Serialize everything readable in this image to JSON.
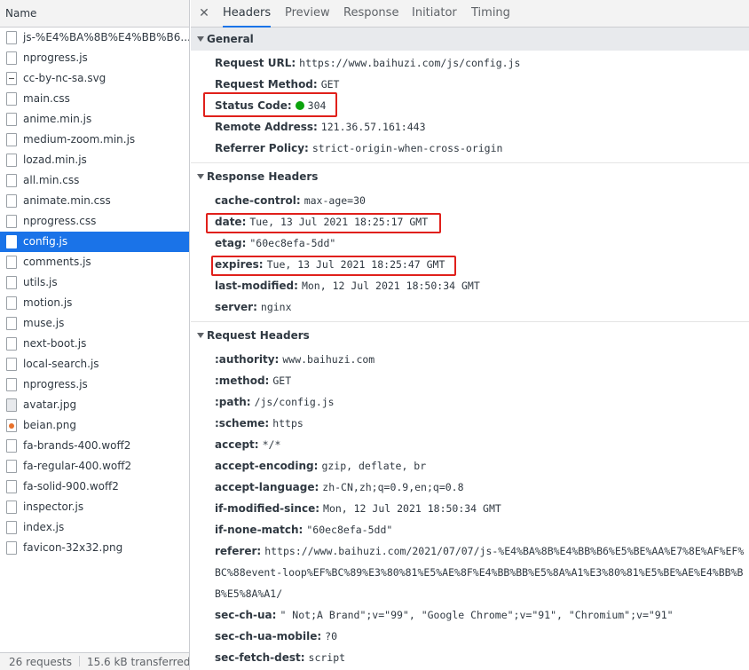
{
  "left_panel": {
    "header": "Name",
    "files": [
      {
        "name": "js-%E4%BA%8B%E4%BB%B6...",
        "type": "doc",
        "selected": false
      },
      {
        "name": "nprogress.js",
        "type": "doc",
        "selected": false
      },
      {
        "name": "cc-by-nc-sa.svg",
        "type": "svg",
        "selected": false
      },
      {
        "name": "main.css",
        "type": "doc",
        "selected": false
      },
      {
        "name": "anime.min.js",
        "type": "doc",
        "selected": false
      },
      {
        "name": "medium-zoom.min.js",
        "type": "doc",
        "selected": false
      },
      {
        "name": "lozad.min.js",
        "type": "doc",
        "selected": false
      },
      {
        "name": "all.min.css",
        "type": "doc",
        "selected": false
      },
      {
        "name": "animate.min.css",
        "type": "doc",
        "selected": false
      },
      {
        "name": "nprogress.css",
        "type": "doc",
        "selected": false
      },
      {
        "name": "config.js",
        "type": "doc",
        "selected": true
      },
      {
        "name": "comments.js",
        "type": "doc",
        "selected": false
      },
      {
        "name": "utils.js",
        "type": "doc",
        "selected": false
      },
      {
        "name": "motion.js",
        "type": "doc",
        "selected": false
      },
      {
        "name": "muse.js",
        "type": "doc",
        "selected": false
      },
      {
        "name": "next-boot.js",
        "type": "doc",
        "selected": false
      },
      {
        "name": "local-search.js",
        "type": "doc",
        "selected": false
      },
      {
        "name": "nprogress.js",
        "type": "doc",
        "selected": false
      },
      {
        "name": "avatar.jpg",
        "type": "img",
        "selected": false
      },
      {
        "name": "beian.png",
        "type": "png",
        "selected": false
      },
      {
        "name": "fa-brands-400.woff2",
        "type": "doc",
        "selected": false
      },
      {
        "name": "fa-regular-400.woff2",
        "type": "doc",
        "selected": false
      },
      {
        "name": "fa-solid-900.woff2",
        "type": "doc",
        "selected": false
      },
      {
        "name": "inspector.js",
        "type": "doc",
        "selected": false
      },
      {
        "name": "index.js",
        "type": "doc",
        "selected": false
      },
      {
        "name": "favicon-32x32.png",
        "type": "doc",
        "selected": false
      }
    ],
    "footer": {
      "requests": "26 requests",
      "transferred": "15.6 kB transferred"
    }
  },
  "tabs": {
    "close_icon": "close-icon",
    "items": [
      "Headers",
      "Preview",
      "Response",
      "Initiator",
      "Timing"
    ],
    "active": "Headers"
  },
  "general": {
    "title": "General",
    "rows": [
      {
        "key": "Request URL:",
        "value": "https://www.baihuzi.com/js/config.js"
      },
      {
        "key": "Request Method:",
        "value": "GET"
      },
      {
        "key": "Status Code:",
        "value": "304",
        "status_color": "#0ca30c"
      },
      {
        "key": "Remote Address:",
        "value": "121.36.57.161:443"
      },
      {
        "key": "Referrer Policy:",
        "value": "strict-origin-when-cross-origin"
      }
    ]
  },
  "response_headers": {
    "title": "Response Headers",
    "rows": [
      {
        "key": "cache-control:",
        "value": "max-age=30"
      },
      {
        "key": "date:",
        "value": "Tue, 13 Jul 2021 18:25:17 GMT"
      },
      {
        "key": "etag:",
        "value": "\"60ec8efa-5dd\""
      },
      {
        "key": "expires:",
        "value": "Tue, 13 Jul 2021 18:25:47 GMT"
      },
      {
        "key": "last-modified:",
        "value": "Mon, 12 Jul 2021 18:50:34 GMT"
      },
      {
        "key": "server:",
        "value": "nginx"
      }
    ]
  },
  "request_headers": {
    "title": "Request Headers",
    "rows": [
      {
        "key": ":authority:",
        "value": "www.baihuzi.com"
      },
      {
        "key": ":method:",
        "value": "GET"
      },
      {
        "key": ":path:",
        "value": "/js/config.js"
      },
      {
        "key": ":scheme:",
        "value": "https"
      },
      {
        "key": "accept:",
        "value": "*/*"
      },
      {
        "key": "accept-encoding:",
        "value": "gzip, deflate, br"
      },
      {
        "key": "accept-language:",
        "value": "zh-CN,zh;q=0.9,en;q=0.8"
      },
      {
        "key": "if-modified-since:",
        "value": "Mon, 12 Jul 2021 18:50:34 GMT"
      },
      {
        "key": "if-none-match:",
        "value": "\"60ec8efa-5dd\""
      },
      {
        "key": "referer:",
        "value": "https://www.baihuzi.com/2021/07/07/js-%E4%BA%8B%E4%BB%B6%E5%BE%AA%E7%8E%AF%EF%BC%88event-loop%EF%BC%89%E3%80%81%E5%AE%8F%E4%BB%BB%E5%8A%A1%E3%80%81%E5%BE%AE%E4%BB%BB%E5%8A%A1/"
      },
      {
        "key": "sec-ch-ua:",
        "value": "\" Not;A Brand\";v=\"99\", \"Google Chrome\";v=\"91\", \"Chromium\";v=\"91\""
      },
      {
        "key": "sec-ch-ua-mobile:",
        "value": "?0"
      },
      {
        "key": "sec-fetch-dest:",
        "value": "script"
      }
    ]
  },
  "highlight_color": "#e0201b"
}
